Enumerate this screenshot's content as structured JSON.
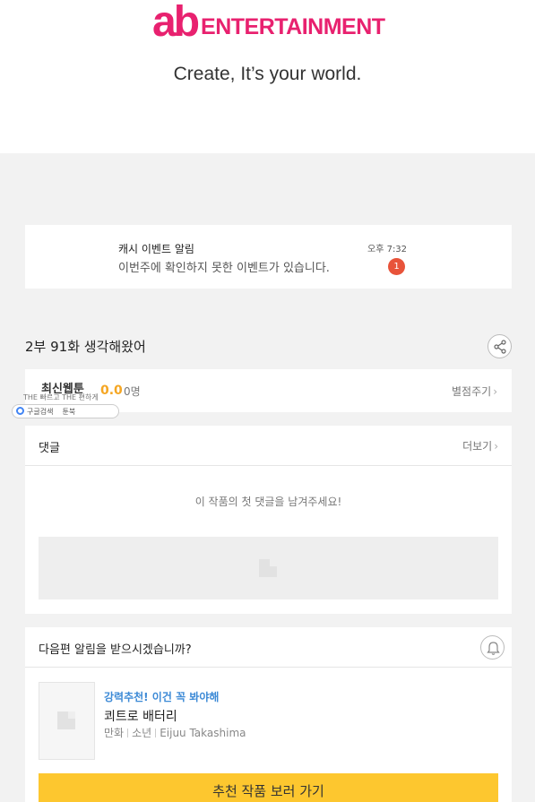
{
  "hero": {
    "logo_mark": "ab",
    "logo_word": "ENTERTAINMENT",
    "tagline": "Create, It’s your world."
  },
  "notification": {
    "title": "캐시 이벤트 알림",
    "message": "이번주에 확인하지 못한 이벤트가 있습니다.",
    "time": "오후 7:32",
    "badge": "1"
  },
  "episode": {
    "title": "2부 91화 생각해왔어",
    "share_icon": "share-icon"
  },
  "rating": {
    "label": "최신웹툰",
    "score": "0.0",
    "count": "0명",
    "action": "별점주기",
    "action_chevron": "›"
  },
  "overlay": {
    "text": "THE 빠르고 THE 편하게",
    "google_label": "구글검색",
    "book_label": "툰북"
  },
  "comments": {
    "title": "댓글",
    "more": "더보기",
    "more_chevron": "›",
    "empty": "이 작품의 첫 댓글을 남겨주세요!"
  },
  "next_episode": {
    "title": "다음편 알림을 받으시겠습니까?",
    "bell_icon": "bell-icon",
    "recommend": {
      "tag": "강력추천! 이건 꼭 봐야해",
      "title": "쾨트로 배터리",
      "genre": "만화",
      "category": "소년",
      "author": "Eijuu Takashima"
    },
    "cta": "추천 작품 보러 가기"
  },
  "colors": {
    "brand": "#e8216f",
    "accent_yellow": "#fdc72f",
    "rating": "#f5a623",
    "badge": "#e8533a",
    "link_blue": "#3d8ad6"
  }
}
